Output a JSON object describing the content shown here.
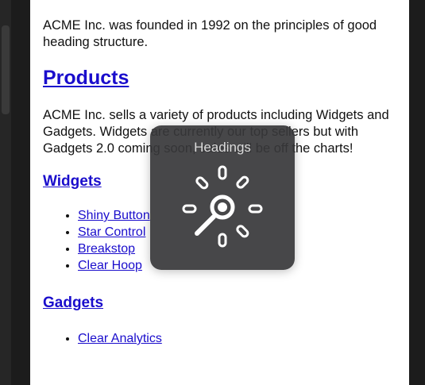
{
  "page": {
    "intro": "ACME Inc. was founded in 1992 on the principles of good heading structure.",
    "products_heading": "Products",
    "products_text": "ACME Inc. sells a variety of products including Widgets and Gadgets. Widgets are currently our top sellers but with Gadgets 2.0 coming soon, sales will be off the charts!",
    "widgets_heading": "Widgets",
    "widgets": [
      "Shiny Button",
      "Star Control",
      "Breakstop",
      "Clear Hoop"
    ],
    "gadgets_heading": "Gadgets",
    "gadgets": [
      "Clear Analytics"
    ]
  },
  "rotor": {
    "title": "Headings",
    "icon": "rotor-dial-icon"
  }
}
